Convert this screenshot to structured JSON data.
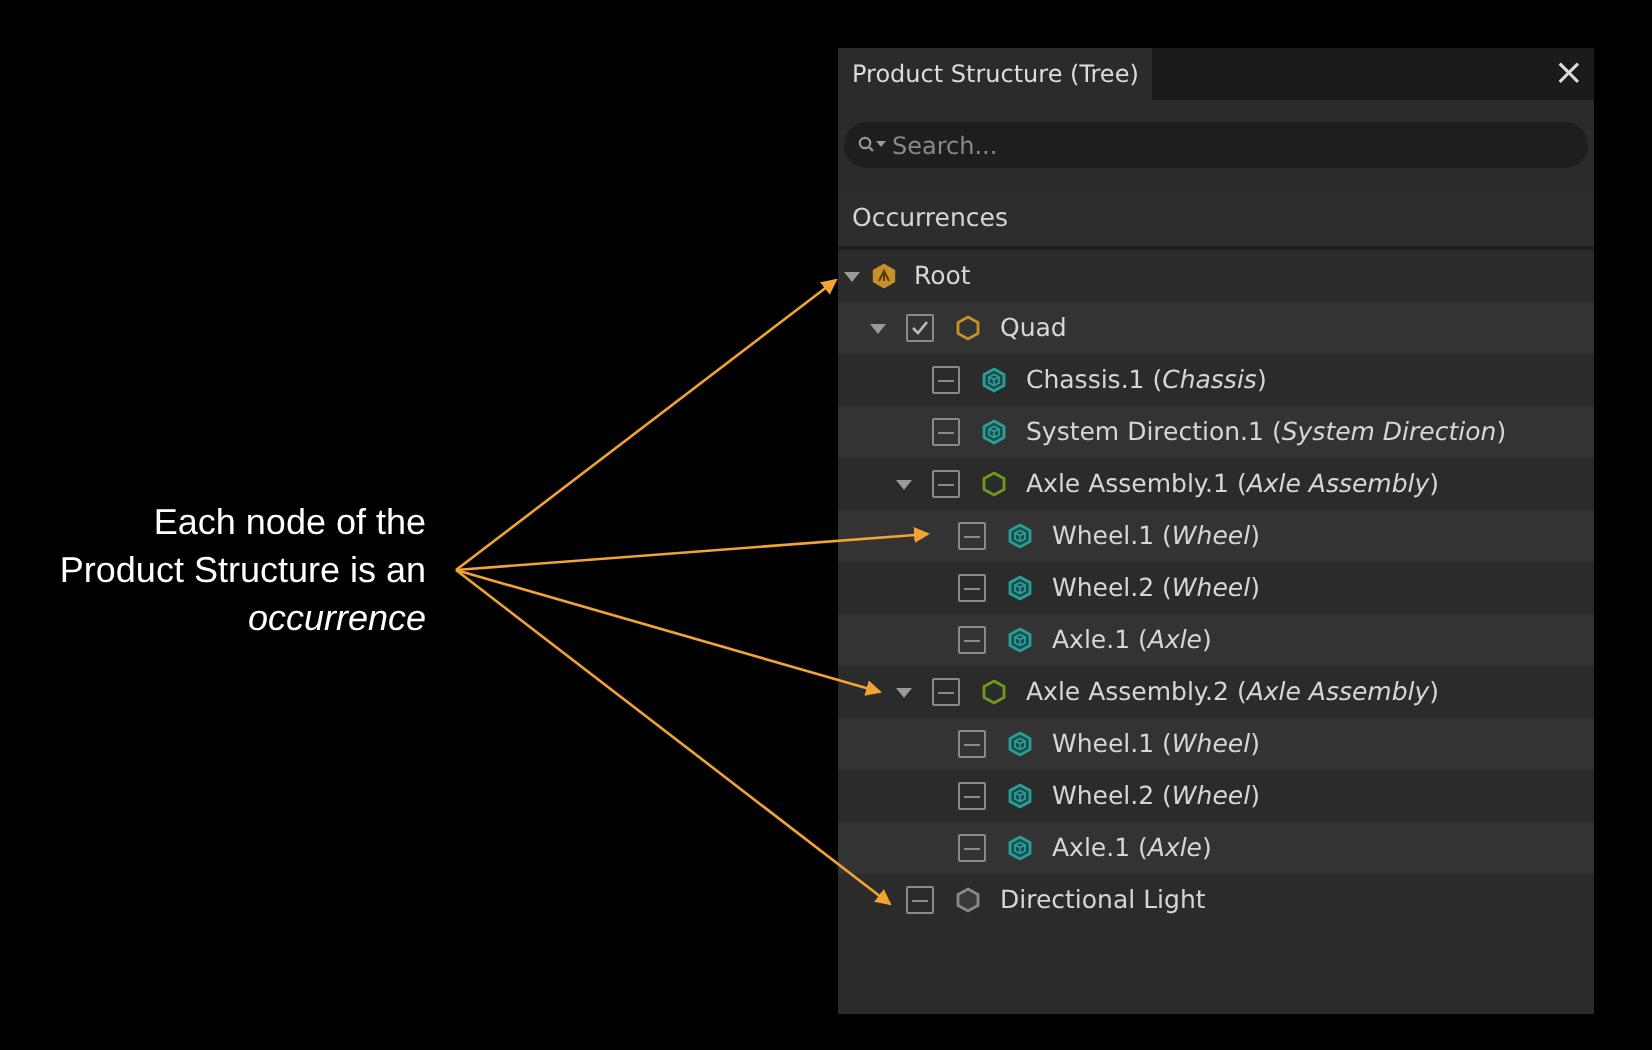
{
  "annotation": {
    "text": "Each node of the Product Structure is an *occurrence*"
  },
  "panel": {
    "tab": {
      "label": "Product Structure (Tree)",
      "selected": true
    },
    "close": "×",
    "search": {
      "placeholder": "Search..."
    },
    "column_header": "Occurrences"
  },
  "tree": [
    {
      "label": "Root",
      "kind": "root",
      "color": "#c8902a",
      "expanded": true,
      "children": [
        {
          "label": "Quad",
          "kind": "assembly",
          "color": "#c8902a",
          "checked": true,
          "expanded": true,
          "children": [
            {
              "label": "Chassis.1 (*Chassis*)",
              "kind": "part",
              "color": "#2a9f9a",
              "checked": false
            },
            {
              "label": "System Direction.1 (*System Direction*)",
              "kind": "part",
              "color": "#2a9f9a",
              "checked": false
            },
            {
              "label": "Axle Assembly.1 (*Axle Assembly*)",
              "kind": "assembly",
              "color": "#6f9a1e",
              "checked": false,
              "expanded": true,
              "children": [
                {
                  "label": "Wheel.1 (*Wheel*)",
                  "kind": "part",
                  "color": "#2a9f9a",
                  "checked": false
                },
                {
                  "label": "Wheel.2 (*Wheel*)",
                  "kind": "part",
                  "color": "#2a9f9a",
                  "checked": false
                },
                {
                  "label": "Axle.1 (*Axle*)",
                  "kind": "part",
                  "color": "#2a9f9a",
                  "checked": false
                }
              ]
            },
            {
              "label": "Axle Assembly.2 (*Axle Assembly*)",
              "kind": "assembly",
              "color": "#6f9a1e",
              "checked": false,
              "expanded": true,
              "children": [
                {
                  "label": "Wheel.1 (*Wheel*)",
                  "kind": "part",
                  "color": "#2a9f9a",
                  "checked": false
                },
                {
                  "label": "Wheel.2 (*Wheel*)",
                  "kind": "part",
                  "color": "#2a9f9a",
                  "checked": false
                },
                {
                  "label": "Axle.1 (*Axle*)",
                  "kind": "part",
                  "color": "#2a9f9a",
                  "checked": false
                }
              ]
            }
          ]
        },
        {
          "label": "Directional Light",
          "kind": "light",
          "color": "#8a8a8a",
          "checked": false
        }
      ]
    }
  ]
}
